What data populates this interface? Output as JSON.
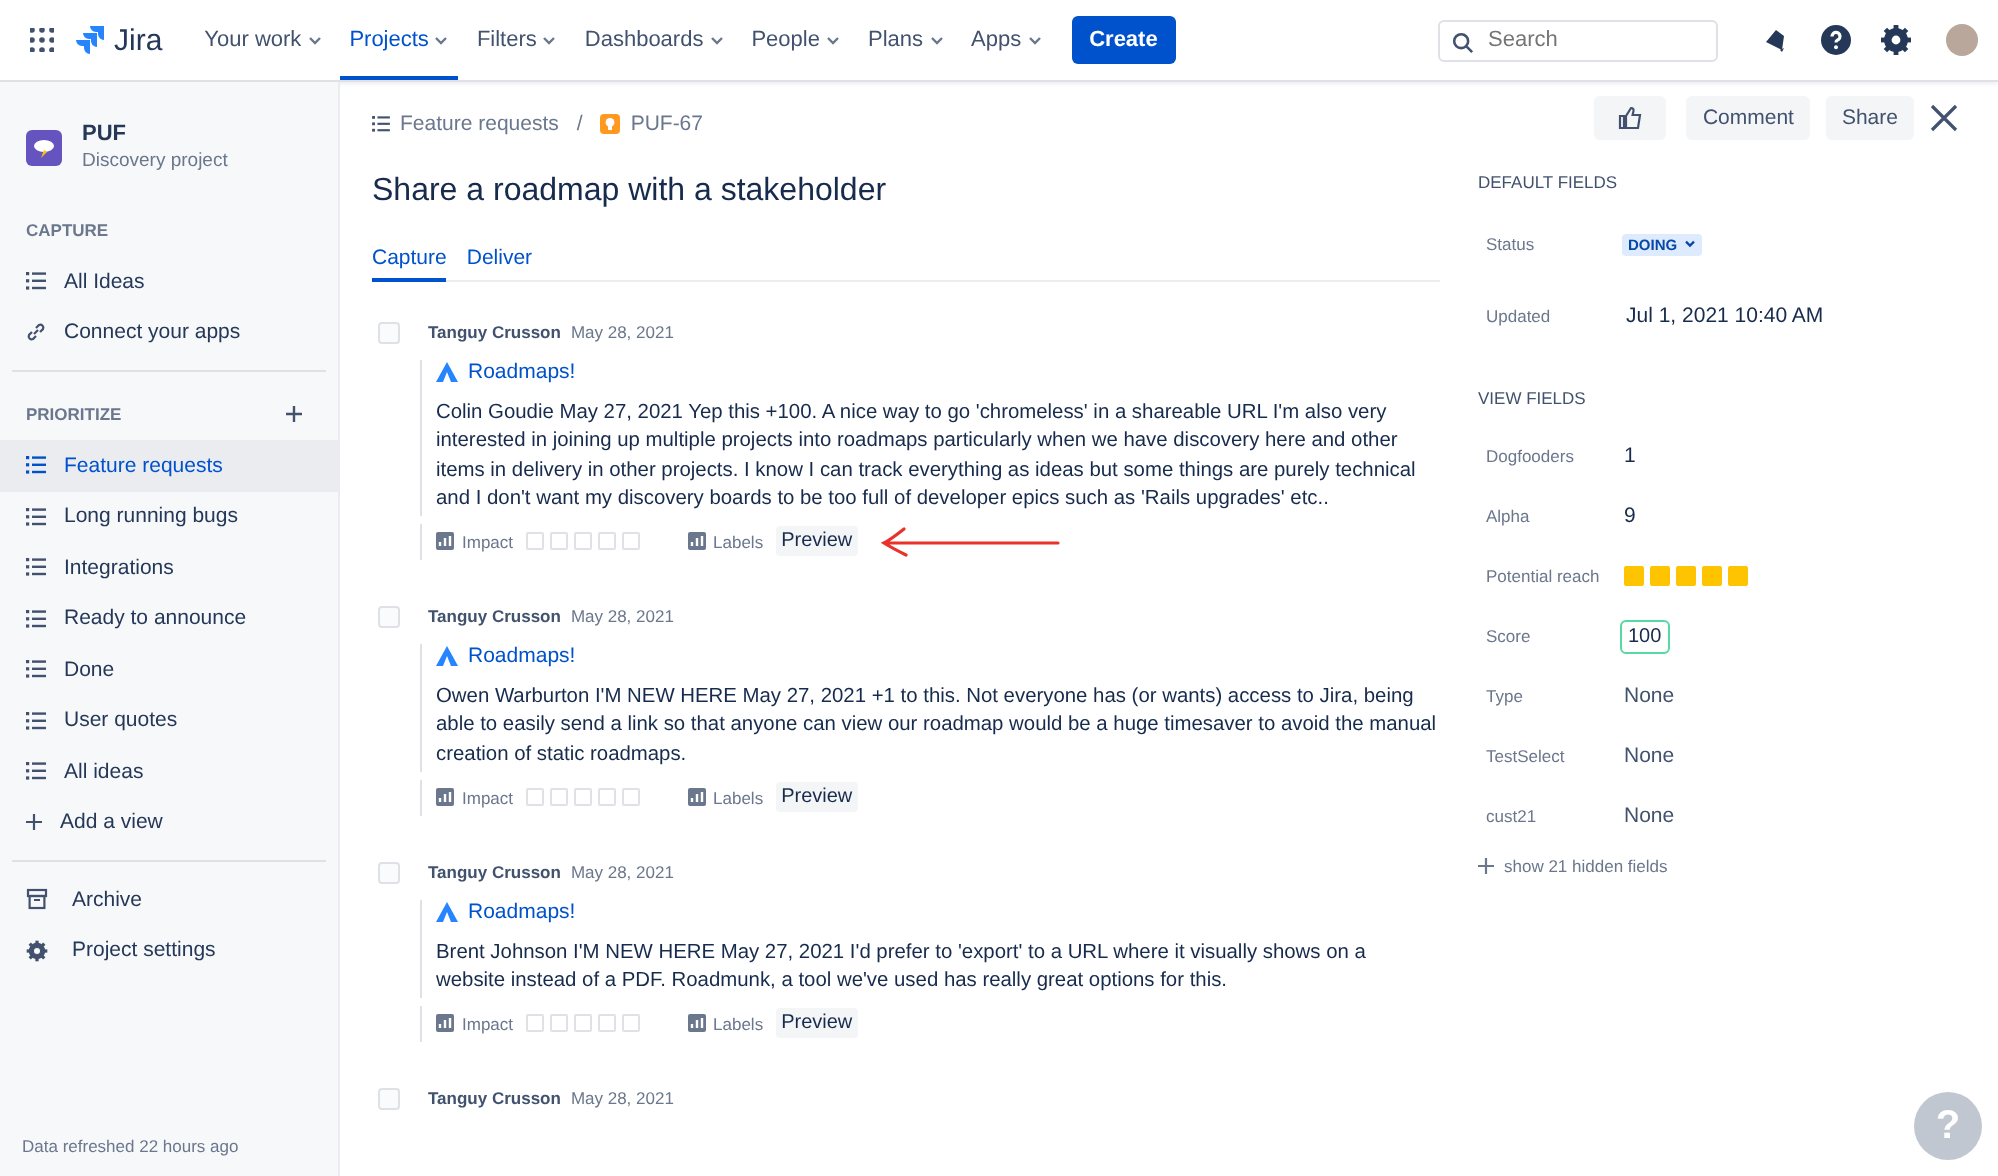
{
  "top_nav": {
    "product": "Jira",
    "items": [
      {
        "label": "Your work",
        "selected": false
      },
      {
        "label": "Projects",
        "selected": true
      },
      {
        "label": "Filters",
        "selected": false
      },
      {
        "label": "Dashboards",
        "selected": false
      },
      {
        "label": "People",
        "selected": false
      },
      {
        "label": "Plans",
        "selected": false
      },
      {
        "label": "Apps",
        "selected": false
      }
    ],
    "create_button": "Create",
    "search": {
      "placeholder": "Search"
    }
  },
  "sidebar": {
    "project": {
      "name": "PUF",
      "type": "Discovery project"
    },
    "sections": [
      {
        "title": "CAPTURE",
        "add_button": false,
        "items": [
          {
            "label": "All Ideas",
            "kind": "view",
            "selected": false
          },
          {
            "label": "Connect your apps",
            "kind": "link",
            "selected": false
          }
        ]
      },
      {
        "title": "PRIORITIZE",
        "add_button": true,
        "items": [
          {
            "label": "Feature requests",
            "kind": "view",
            "selected": true
          },
          {
            "label": "Long running bugs",
            "kind": "view",
            "selected": false
          },
          {
            "label": "Integrations",
            "kind": "view",
            "selected": false
          },
          {
            "label": "Ready to announce",
            "kind": "view",
            "selected": false
          },
          {
            "label": "Done",
            "kind": "view",
            "selected": false
          },
          {
            "label": "User quotes",
            "kind": "view",
            "selected": false
          },
          {
            "label": "All ideas",
            "kind": "view",
            "selected": false
          },
          {
            "label": "Add a view",
            "kind": "add",
            "selected": false
          }
        ]
      },
      {
        "items": [
          {
            "label": "Archive",
            "kind": "archive",
            "selected": false
          },
          {
            "label": "Project settings",
            "kind": "settings",
            "selected": false
          }
        ]
      }
    ],
    "footer": "Data refreshed 22 hours ago"
  },
  "breadcrumb": {
    "parent": "Feature requests",
    "separator": "/",
    "key": "PUF-67"
  },
  "title": "Share a roadmap with a stakeholder",
  "tabs": [
    {
      "label": "Capture",
      "selected": true
    },
    {
      "label": "Deliver",
      "selected": false
    }
  ],
  "comments": [
    {
      "author": "Tanguy Crusson",
      "date": "May 28, 2021",
      "checked": false,
      "link": "Roadmaps!",
      "text": "Colin Goudie May 27, 2021 Yep this +100. A nice way to go 'chromeless' in a shareable URL I'm also very interested in joining up multiple projects into roadmaps particularly when we have discovery here and other items in delivery in other projects. I know I can track everything as ideas but some things are purely technical and I don't want my discovery boards to be too full of developer epics such as 'Rails upgrades' etc..",
      "impact_label": "Impact",
      "stars": 0,
      "labels_label": "Labels",
      "preview": "Preview",
      "arrow_annotation": true
    },
    {
      "author": "Tanguy Crusson",
      "date": "May 28, 2021",
      "checked": false,
      "link": "Roadmaps!",
      "text": "Owen Warburton I'M NEW HERE May 27, 2021 +1 to this. Not everyone has (or wants) access to Jira, being able to easily send a link so that anyone can view our roadmap would be a huge timesaver to avoid the manual creation of static roadmaps.",
      "impact_label": "Impact",
      "stars": 0,
      "labels_label": "Labels",
      "preview": "Preview",
      "arrow_annotation": false
    },
    {
      "author": "Tanguy Crusson",
      "date": "May 28, 2021",
      "checked": false,
      "link": "Roadmaps!",
      "text": "Brent Johnson I'M NEW HERE May 27, 2021 I'd prefer to 'export' to a URL where it visually shows on a website instead of a PDF. Roadmunk, a tool we've used has really great options for this.",
      "impact_label": "Impact",
      "stars": 0,
      "labels_label": "Labels",
      "preview": "Preview",
      "arrow_annotation": false
    },
    {
      "author": "Tanguy Crusson",
      "date": "May 28, 2021",
      "checked": false
    }
  ],
  "actions": {
    "comment": "Comment",
    "share": "Share"
  },
  "default_fields": {
    "title": "DEFAULT FIELDS",
    "status": {
      "label": "Status",
      "value": "DOING"
    },
    "updated": {
      "label": "Updated",
      "value": "Jul 1, 2021 10:40 AM"
    }
  },
  "view_fields": {
    "title": "VIEW FIELDS",
    "fields": [
      {
        "label": "Dogfooders",
        "kind": "number",
        "value": "1"
      },
      {
        "label": "Alpha",
        "kind": "number",
        "value": "9"
      },
      {
        "label": "Potential reach",
        "kind": "rating",
        "stars": 5
      },
      {
        "label": "Score",
        "kind": "score",
        "value": "100"
      },
      {
        "label": "Type",
        "kind": "empty",
        "value": "None"
      },
      {
        "label": "TestSelect",
        "kind": "empty",
        "value": "None"
      },
      {
        "label": "cust21",
        "kind": "empty",
        "value": "None"
      }
    ],
    "more": "show 21 hidden fields"
  },
  "help_button": "?"
}
